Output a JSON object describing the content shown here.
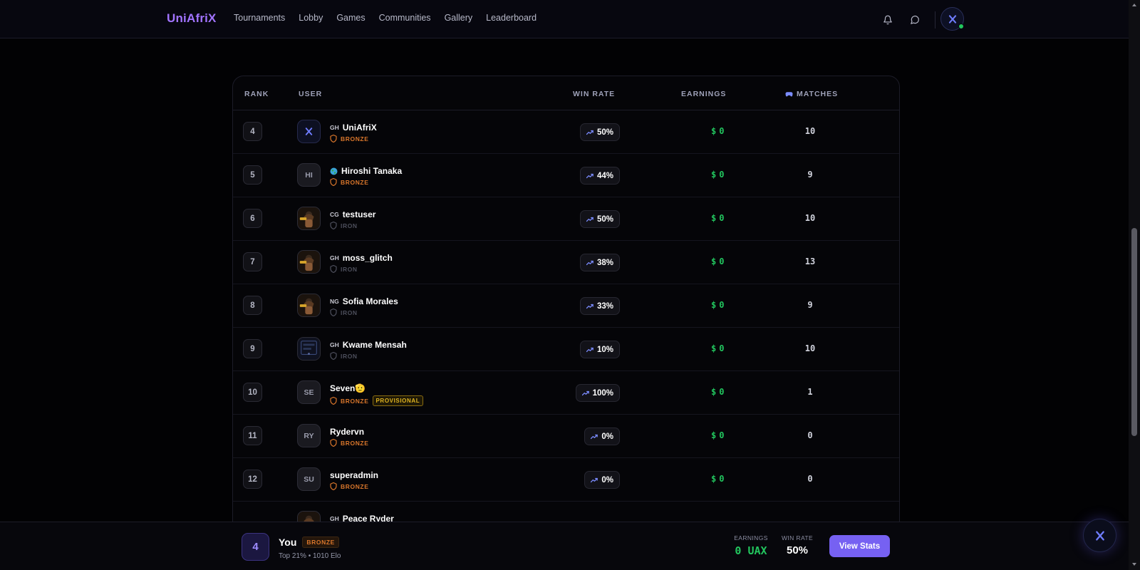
{
  "nav": {
    "brand": "UniAfriX",
    "links": [
      "Tournaments",
      "Lobby",
      "Games",
      "Communities",
      "Gallery",
      "Leaderboard"
    ]
  },
  "table": {
    "headers": {
      "rank": "RANK",
      "user": "USER",
      "win_rate": "WIN RATE",
      "earnings": "EARNINGS",
      "matches": "MATCHES"
    },
    "rows": [
      {
        "rank": "4",
        "avatar": "logo",
        "initials": "",
        "country": "GH",
        "name": "UniAfriX",
        "tier": "BRONZE",
        "tier_class": "bronze",
        "provisional": "",
        "win_rate": "50%",
        "currency": "$",
        "earnings": "0",
        "matches": "10"
      },
      {
        "rank": "5",
        "avatar": "text",
        "initials": "HI",
        "country": "",
        "name": "Hiroshi Tanaka",
        "tier": "BRONZE",
        "tier_class": "bronze",
        "provisional": "",
        "win_rate": "44%",
        "currency": "$",
        "earnings": "0",
        "matches": "9"
      },
      {
        "rank": "6",
        "avatar": "photo",
        "initials": "",
        "country": "CG",
        "name": "testuser",
        "tier": "IRON",
        "tier_class": "iron",
        "provisional": "",
        "win_rate": "50%",
        "currency": "$",
        "earnings": "0",
        "matches": "10"
      },
      {
        "rank": "7",
        "avatar": "photo",
        "initials": "",
        "country": "GH",
        "name": "moss_glitch",
        "tier": "IRON",
        "tier_class": "iron",
        "provisional": "",
        "win_rate": "38%",
        "currency": "$",
        "earnings": "0",
        "matches": "13"
      },
      {
        "rank": "8",
        "avatar": "photo",
        "initials": "",
        "country": "NG",
        "name": "Sofia Morales",
        "tier": "IRON",
        "tier_class": "iron",
        "provisional": "",
        "win_rate": "33%",
        "currency": "$",
        "earnings": "0",
        "matches": "9"
      },
      {
        "rank": "9",
        "avatar": "dark",
        "initials": "",
        "country": "GH",
        "name": "Kwame Mensah",
        "tier": "IRON",
        "tier_class": "iron",
        "provisional": "",
        "win_rate": "10%",
        "currency": "$",
        "earnings": "0",
        "matches": "10"
      },
      {
        "rank": "10",
        "avatar": "text",
        "initials": "SE",
        "country": "",
        "name": "Seven🫡",
        "tier": "BRONZE",
        "tier_class": "bronze",
        "provisional": "PROVISIONAL",
        "win_rate": "100%",
        "currency": "$",
        "earnings": "0",
        "matches": "1"
      },
      {
        "rank": "11",
        "avatar": "text",
        "initials": "RY",
        "country": "",
        "name": "Rydervn",
        "tier": "BRONZE",
        "tier_class": "bronze",
        "provisional": "",
        "win_rate": "0%",
        "currency": "$",
        "earnings": "0",
        "matches": "0"
      },
      {
        "rank": "12",
        "avatar": "text",
        "initials": "SU",
        "country": "",
        "name": "superadmin",
        "tier": "BRONZE",
        "tier_class": "bronze",
        "provisional": "",
        "win_rate": "0%",
        "currency": "$",
        "earnings": "0",
        "matches": "0"
      },
      {
        "rank": "",
        "avatar": "photo",
        "initials": "",
        "country": "GH",
        "name": "Peace Ryder",
        "tier": "",
        "tier_class": "bronze",
        "provisional": "",
        "win_rate": "",
        "currency": "",
        "earnings": "",
        "matches": ""
      }
    ]
  },
  "me": {
    "rank": "4",
    "name": "You",
    "tier": "BRONZE",
    "subtitle": "Top 21% • 1010 Elo",
    "earnings_label": "EARNINGS",
    "earnings_value": "0 UAX",
    "win_rate_label": "WIN RATE",
    "win_rate_value": "50%",
    "button": "View Stats"
  },
  "icons": {
    "notifications": "bell-icon",
    "messages": "chat-icon",
    "matches_header": "gamepad-icon",
    "trend": "trending-up-icon",
    "tier": "shield-icon"
  },
  "colors": {
    "brand": "#a274ff",
    "accent": "#7661f2",
    "earnings": "#22c55e",
    "bronze": "#d9762b",
    "iron": "#4d4f5c",
    "provisional": "#e0b421"
  }
}
